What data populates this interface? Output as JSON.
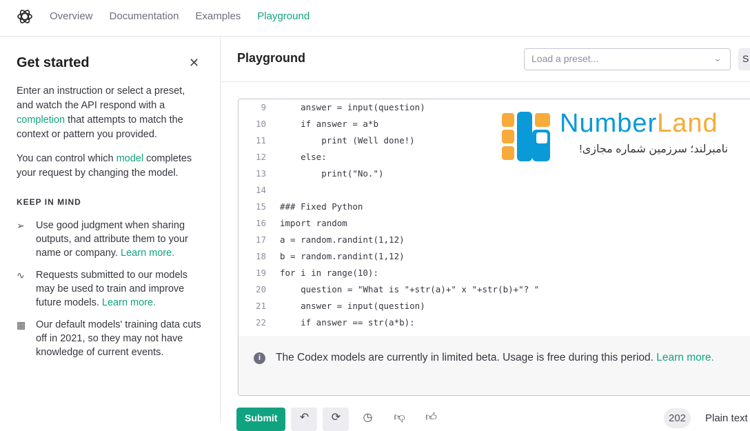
{
  "nav": {
    "items": [
      {
        "label": "Overview"
      },
      {
        "label": "Documentation"
      },
      {
        "label": "Examples"
      },
      {
        "label": "Playground",
        "active": true
      }
    ]
  },
  "sidebar": {
    "title": "Get started",
    "intro_1a": "Enter an instruction or select a preset, and watch the API respond with a ",
    "intro_1_link": "completion",
    "intro_1b": " that attempts to match the context or pattern you provided.",
    "intro_2a": "You can control which ",
    "intro_2_link": "model",
    "intro_2b": " completes your request by changing the model.",
    "keep_title": "KEEP IN MIND",
    "tips": [
      {
        "icon": "send-icon",
        "text": "Use good judgment when sharing outputs, and attribute them to your name or company. ",
        "link": "Learn more."
      },
      {
        "icon": "activity-icon",
        "text": "Requests submitted to our models may be used to train and improve future models. ",
        "link": "Learn more."
      },
      {
        "icon": "calendar-icon",
        "text": "Our default models' training data cuts off in 2021, so they may not have knowledge of current events.",
        "link": ""
      }
    ]
  },
  "main": {
    "title": "Playground",
    "preset_placeholder": "Load a preset...",
    "save_label": "S"
  },
  "code": [
    {
      "n": "9",
      "t": "    answer = input(question)"
    },
    {
      "n": "10",
      "t": "    if answer = a*b"
    },
    {
      "n": "11",
      "t": "        print (Well done!)"
    },
    {
      "n": "12",
      "t": "    else:"
    },
    {
      "n": "13",
      "t": "        print(\"No.\")"
    },
    {
      "n": "14",
      "t": ""
    },
    {
      "n": "15",
      "t": "### Fixed Python"
    },
    {
      "n": "16",
      "t": "import random"
    },
    {
      "n": "17",
      "t": "a = random.randint(1,12)"
    },
    {
      "n": "18",
      "t": "b = random.randint(1,12)"
    },
    {
      "n": "19",
      "t": "for i in range(10):"
    },
    {
      "n": "20",
      "t": "    question = \"What is \"+str(a)+\" x \"+str(b)+\"? \""
    },
    {
      "n": "21",
      "t": "    answer = input(question)"
    },
    {
      "n": "22",
      "t": "    if answer == str(a*b):"
    }
  ],
  "watermark": {
    "brand_a": "Number",
    "brand_b": "Land",
    "tagline": "نامبرلند؛ سرزمین شماره مجازی!"
  },
  "banner": {
    "text": "The Codex models are currently in limited beta. Usage is free during this period. ",
    "link": "Learn more."
  },
  "footer": {
    "submit": "Submit",
    "token_count": "202",
    "mode": "Plain text"
  },
  "colors": {
    "accent": "#10a37f",
    "brand_blue": "#0a9ad8",
    "brand_orange": "#f7ab3a"
  }
}
